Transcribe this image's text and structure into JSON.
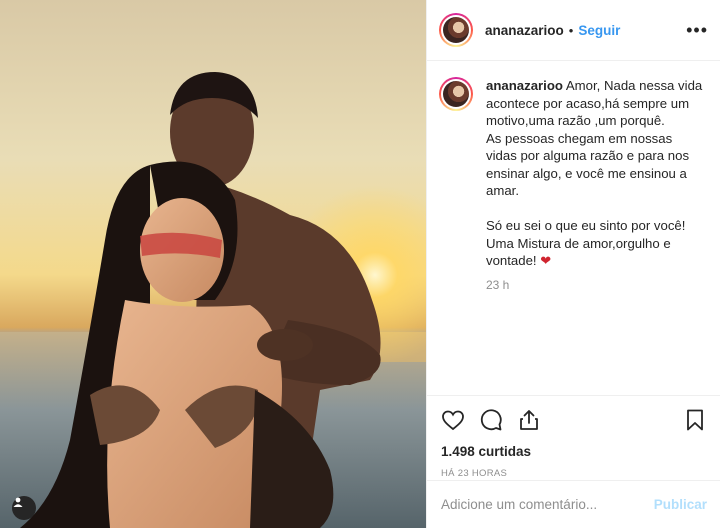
{
  "post": {
    "photo_alt": "",
    "tag_icon": "user-tag-icon"
  },
  "header": {
    "username": "ananazarioo",
    "separator": "•",
    "follow_label": "Seguir",
    "more_label": "•••"
  },
  "caption": {
    "username": "ananazarioo",
    "text": " Amor, Nada nessa vida acontece por acaso,há sempre um motivo,uma razão ,um porquê.\nAs pessoas chegam em nossas vidas por alguma razão e para nos ensinar algo, e você me ensinou a amar.\n\nSó eu sei o que eu sinto por você! Uma Mistura de amor,orgulho e vontade! ",
    "emoji": "❤",
    "time": "23 h"
  },
  "actions": {
    "like_icon": "heart-icon",
    "comment_icon": "comment-icon",
    "share_icon": "share-icon",
    "save_icon": "bookmark-icon",
    "likes": "1.498 curtidas",
    "posted": "HÁ 23 HORAS"
  },
  "comment": {
    "placeholder": "Adicione um comentário...",
    "publish_label": "Publicar"
  },
  "colors": {
    "accent": "#3897f0",
    "publish_disabled": "#b2dffc",
    "muted": "#8e8e8e"
  }
}
